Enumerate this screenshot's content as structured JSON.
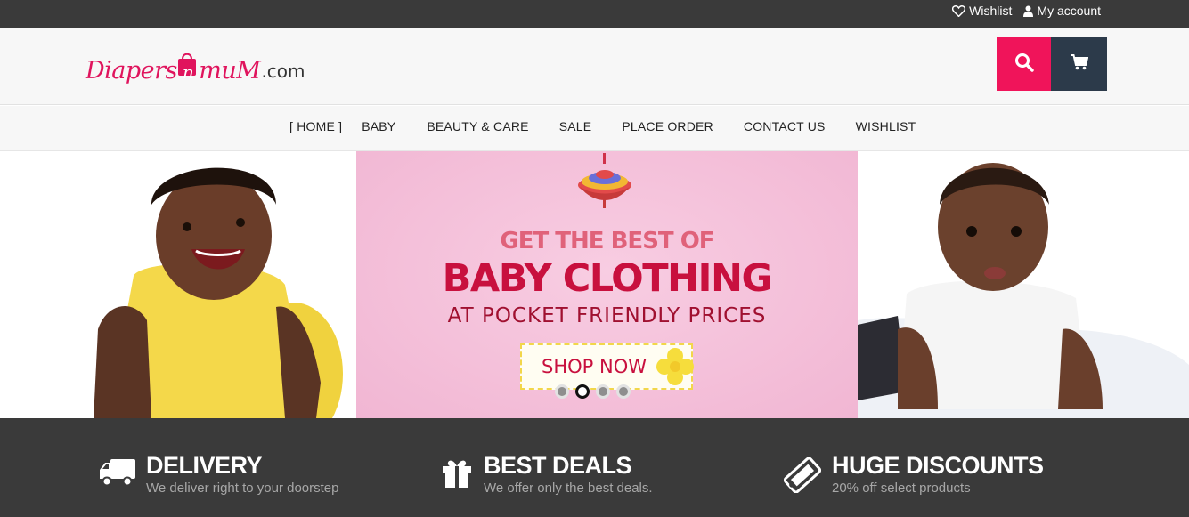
{
  "topbar": {
    "wishlist_label": "Wishlist",
    "account_label": "My account"
  },
  "logo": {
    "part1": "Diapers",
    "part2": "n",
    "part3": "muM",
    "part4": ".com",
    "brand_color": "#e0145d"
  },
  "header": {
    "search_icon": "search-icon",
    "cart_icon": "cart-icon",
    "search_color": "#f0145a",
    "cart_color": "#2c3a4a"
  },
  "nav": {
    "items": [
      {
        "label": "HOME",
        "active": true
      },
      {
        "label": "BABY"
      },
      {
        "label": "BEAUTY & CARE"
      },
      {
        "label": "SALE"
      },
      {
        "label": "PLACE ORDER"
      },
      {
        "label": "CONTACT US"
      },
      {
        "label": "WISHLIST"
      }
    ]
  },
  "hero": {
    "line1": "GET THE BEST OF",
    "line2": "BABY CLOTHING",
    "line3": "AT POCKET FRIENDLY PRICES",
    "cta_label": "SHOP NOW",
    "slide_count": 4,
    "active_slide": 2
  },
  "features": [
    {
      "icon": "truck-icon",
      "title": "DELIVERY",
      "subtitle": "We deliver right to your doorstep"
    },
    {
      "icon": "gift-icon",
      "title": "BEST DEALS",
      "subtitle": "We offer only the best deals."
    },
    {
      "icon": "tag-icon",
      "title": "HUGE DISCOUNTS",
      "subtitle": "20% off select products"
    }
  ]
}
